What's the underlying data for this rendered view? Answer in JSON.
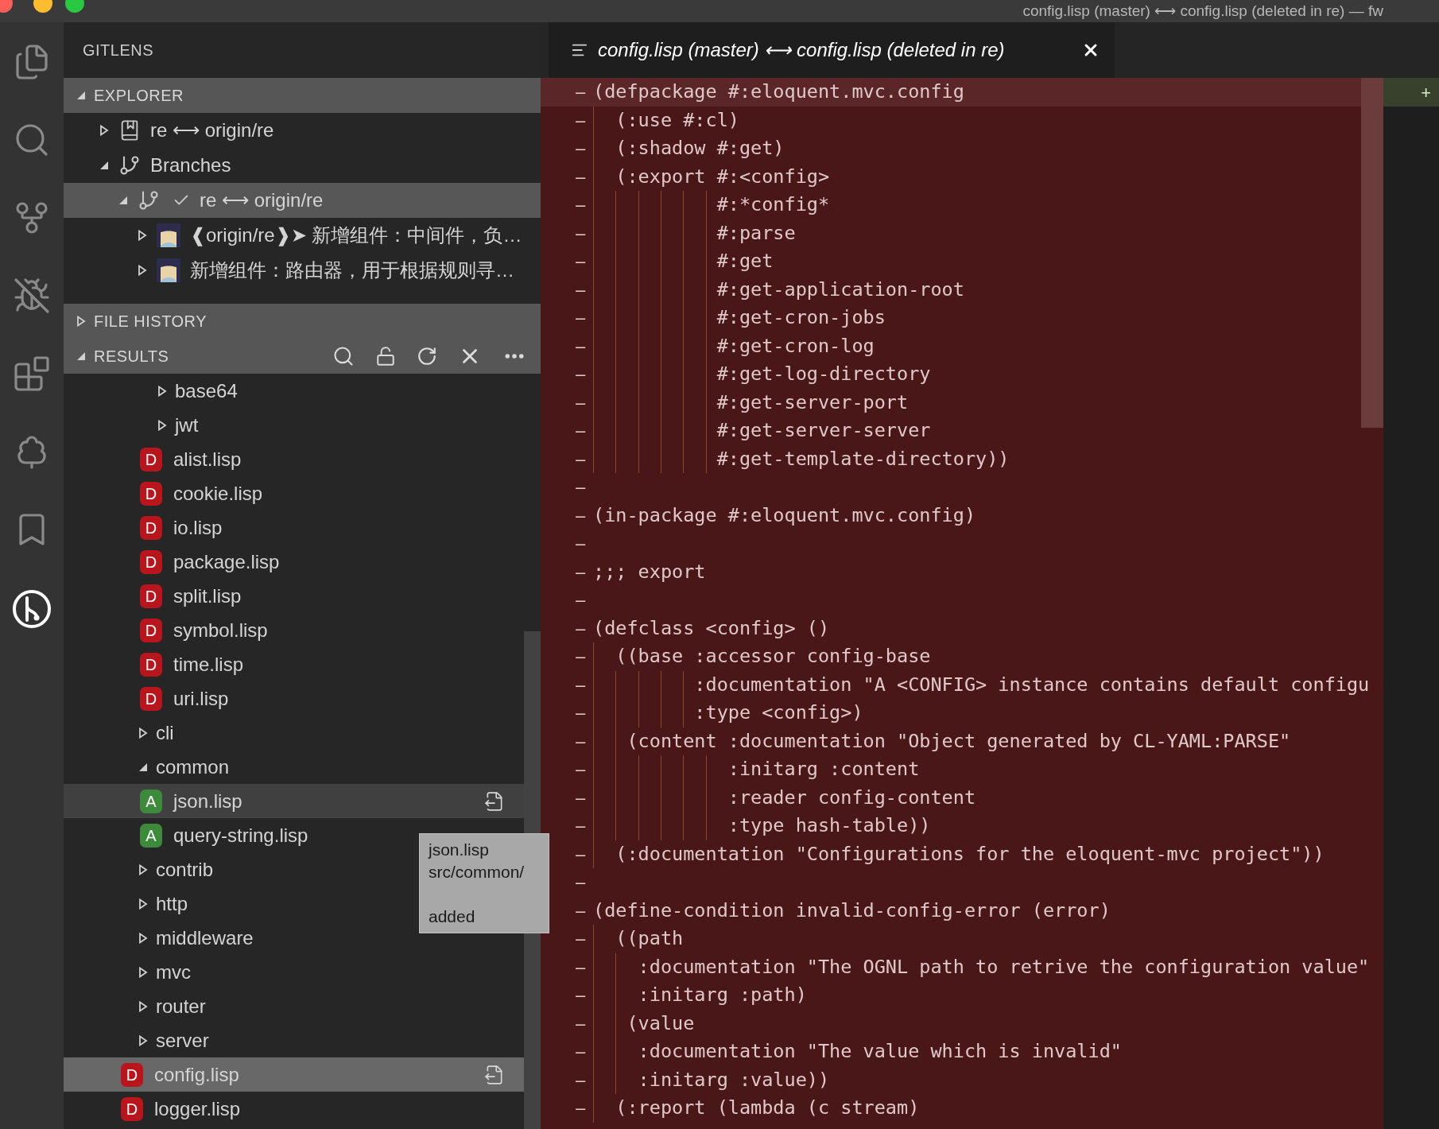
{
  "window": {
    "title": "config.lisp (master) ⟷ config.lisp (deleted in re) — fw"
  },
  "activity_bar": [
    {
      "kind": "files",
      "selected": false
    },
    {
      "kind": "search",
      "selected": false
    },
    {
      "kind": "source-control",
      "selected": false
    },
    {
      "kind": "debug",
      "selected": false
    },
    {
      "kind": "extensions",
      "selected": false
    },
    {
      "kind": "tree",
      "selected": false
    },
    {
      "kind": "bookmarks",
      "selected": false
    },
    {
      "kind": "gitlens",
      "selected": true
    }
  ],
  "sidebar": {
    "title": "GITLENS",
    "sections": [
      {
        "kind": "explorer",
        "title": "EXPLORER",
        "expanded": true,
        "items": [
          {
            "kind": "repository",
            "label": "re ⟷ origin/re",
            "expanded": false,
            "selected": false
          },
          {
            "kind": "branches",
            "label": "Branches",
            "expanded": true,
            "selected": false,
            "children": [
              {
                "kind": "branch",
                "label": "re ⟷ origin/re",
                "current": true,
                "expanded": true,
                "selected": true,
                "children": [
                  {
                    "kind": "commit",
                    "label": "❰origin/re❱➤  新增组件：中间件，负…",
                    "expanded": false,
                    "selected": false
                  },
                  {
                    "kind": "commit",
                    "label": "新增组件：路由器，用于根据规则寻…",
                    "expanded": false,
                    "selected": false
                  }
                ]
              }
            ]
          }
        ]
      },
      {
        "kind": "history",
        "title": "FILE HISTORY",
        "expanded": false
      },
      {
        "kind": "results",
        "title": "RESULTS",
        "expanded": true,
        "items": [
          {
            "kind": "scrolled",
            "children": [
              {
                "kind": "folder",
                "label": "base64",
                "expanded": false,
                "selected": false,
                "hovered": false
              },
              {
                "kind": "folder",
                "label": "jwt",
                "expanded": false,
                "selected": false,
                "hovered": false
              },
              {
                "kind": "file",
                "badge": "D",
                "color": "#b8161c",
                "label": "alist.lisp",
                "selected": false,
                "hovered": false
              },
              {
                "kind": "file",
                "badge": "D",
                "color": "#b8161c",
                "label": "cookie.lisp",
                "selected": false,
                "hovered": false
              },
              {
                "kind": "file",
                "badge": "D",
                "color": "#b8161c",
                "label": "io.lisp",
                "selected": false,
                "hovered": false
              },
              {
                "kind": "file",
                "badge": "D",
                "color": "#b8161c",
                "label": "package.lisp",
                "selected": false,
                "hovered": false
              },
              {
                "kind": "file",
                "badge": "D",
                "color": "#b8161c",
                "label": "split.lisp",
                "selected": false,
                "hovered": false
              },
              {
                "kind": "file",
                "badge": "D",
                "color": "#b8161c",
                "label": "symbol.lisp",
                "selected": false,
                "hovered": false
              },
              {
                "kind": "file",
                "badge": "D",
                "color": "#b8161c",
                "label": "time.lisp",
                "selected": false,
                "hovered": false
              },
              {
                "kind": "file",
                "badge": "D",
                "color": "#b8161c",
                "label": "uri.lisp",
                "selected": false,
                "hovered": false
              }
            ]
          },
          {
            "kind": "folder",
            "label": "cli",
            "expanded": false,
            "selected": false,
            "hovered": false
          },
          {
            "kind": "folder",
            "label": "common",
            "expanded": true,
            "selected": false,
            "hovered": false,
            "children": [
              {
                "kind": "file",
                "badge": "A",
                "color": "#3c8a3a",
                "label": "json.lisp",
                "selected": false,
                "hovered": true
              },
              {
                "kind": "file",
                "badge": "A",
                "color": "#3c8a3a",
                "label": "query-string.lisp",
                "selected": false,
                "hovered": false
              }
            ]
          },
          {
            "kind": "folder",
            "label": "contrib",
            "expanded": false,
            "selected": false,
            "hovered": false
          },
          {
            "kind": "folder",
            "label": "http",
            "expanded": false,
            "selected": false,
            "hovered": false
          },
          {
            "kind": "folder",
            "label": "middleware",
            "expanded": false,
            "selected": false,
            "hovered": false
          },
          {
            "kind": "folder",
            "label": "mvc",
            "expanded": false,
            "selected": false,
            "hovered": false
          },
          {
            "kind": "folder",
            "label": "router",
            "expanded": false,
            "selected": false,
            "hovered": false
          },
          {
            "kind": "folder",
            "label": "server",
            "expanded": false,
            "selected": false,
            "hovered": false
          },
          {
            "kind": "file",
            "badge": "D",
            "color": "#b8161c",
            "label": "config.lisp",
            "selected": true,
            "hovered": false
          },
          {
            "kind": "file",
            "badge": "D",
            "color": "#b8161c",
            "label": "logger.lisp",
            "selected": false,
            "hovered": false
          }
        ]
      }
    ]
  },
  "tooltip": {
    "name": "json.lisp",
    "path": "src/common/",
    "status": "added"
  },
  "editor": {
    "tab": {
      "title": "config.lisp (master) ⟷ config.lisp (deleted in re)",
      "preview": true
    },
    "marker": "–",
    "other_side": {
      "marker": "+"
    },
    "lines": [
      {
        "text": "(defpackage #:eloquent.mvc.config",
        "current": true
      },
      {
        "text": "  (:use #:cl)",
        "current": false
      },
      {
        "text": "  (:shadow #:get)",
        "current": false
      },
      {
        "text": "  (:export #:<config>",
        "current": false
      },
      {
        "text": "           #:*config*",
        "current": false
      },
      {
        "text": "           #:parse",
        "current": false
      },
      {
        "text": "           #:get",
        "current": false
      },
      {
        "text": "           #:get-application-root",
        "current": false
      },
      {
        "text": "           #:get-cron-jobs",
        "current": false
      },
      {
        "text": "           #:get-cron-log",
        "current": false
      },
      {
        "text": "           #:get-log-directory",
        "current": false
      },
      {
        "text": "           #:get-server-port",
        "current": false
      },
      {
        "text": "           #:get-server-server",
        "current": false
      },
      {
        "text": "           #:get-template-directory))",
        "current": false
      },
      {
        "current": false
      },
      {
        "text": "(in-package #:eloquent.mvc.config)",
        "current": false
      },
      {
        "current": false
      },
      {
        "text": ";;; export",
        "current": false
      },
      {
        "current": false
      },
      {
        "text": "(defclass <config> ()",
        "current": false
      },
      {
        "text": "  ((base :accessor config-base",
        "current": false
      },
      {
        "text": "         :documentation \"A <CONFIG> instance contains default configu",
        "current": false
      },
      {
        "text": "         :type <config>)",
        "current": false
      },
      {
        "text": "   (content :documentation \"Object generated by CL-YAML:PARSE\"",
        "current": false
      },
      {
        "text": "            :initarg :content",
        "current": false
      },
      {
        "text": "            :reader config-content",
        "current": false
      },
      {
        "text": "            :type hash-table))",
        "current": false
      },
      {
        "text": "  (:documentation \"Configurations for the eloquent-mvc project\"))",
        "current": false
      },
      {
        "current": false
      },
      {
        "text": "(define-condition invalid-config-error (error)",
        "current": false
      },
      {
        "text": "  ((path",
        "current": false
      },
      {
        "text": "    :documentation \"The OGNL path to retrive the configuration value\"",
        "current": false
      },
      {
        "text": "    :initarg :path)",
        "current": false
      },
      {
        "text": "   (value",
        "current": false
      },
      {
        "text": "    :documentation \"The value which is invalid\"",
        "current": false
      },
      {
        "text": "    :initarg :value))",
        "current": false
      },
      {
        "text": "  (:report (lambda (c stream)",
        "current": false
      }
    ]
  }
}
